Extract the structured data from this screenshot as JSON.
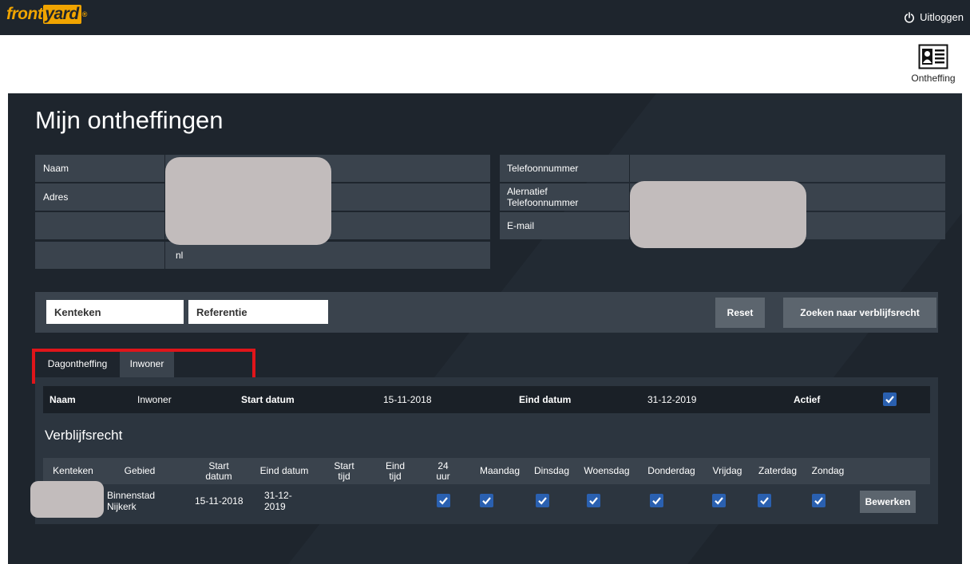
{
  "topbar": {
    "logo_part1": "front",
    "logo_part2": "yard",
    "logo_reg": "®",
    "logout_label": "Uitloggen"
  },
  "nav": {
    "ontheffing_label": "Ontheffing"
  },
  "page": {
    "title": "Mijn ontheffingen"
  },
  "info": {
    "left": {
      "naam_label": "Naam",
      "adres_label": "Adres",
      "country_value": "nl"
    },
    "right": {
      "telefoon_label": "Telefoonnummer",
      "alt_telefoon_label": "Alernatief Telefoonnummer",
      "email_label": "E-mail"
    }
  },
  "search": {
    "kenteken_placeholder": "Kenteken",
    "referentie_placeholder": "Referentie",
    "reset_label": "Reset",
    "zoeken_label": "Zoeken naar verblijfsrecht"
  },
  "tabs": [
    {
      "label": "Dagontheffing",
      "active": true
    },
    {
      "label": "Inwoner",
      "active": false
    }
  ],
  "summary": {
    "naam_label": "Naam",
    "naam_value": "Inwoner",
    "start_label": "Start datum",
    "start_value": "15-11-2018",
    "eind_label": "Eind datum",
    "eind_value": "31-12-2019",
    "actief_label": "Actief",
    "actief_checked": true
  },
  "verblijfsrecht": {
    "title": "Verblijfsrecht",
    "columns": [
      "Kenteken",
      "Gebied",
      "Start datum",
      "Eind datum",
      "Start tijd",
      "Eind tijd",
      "24 uur",
      "Maandag",
      "Dinsdag",
      "Woensdag",
      "Donderdag",
      "Vrijdag",
      "Zaterdag",
      "Zondag"
    ],
    "rows": [
      {
        "gebied": "Binnenstad Nijkerk",
        "start_datum": "15-11-2018",
        "eind_datum": "31-12-2019",
        "checks": [
          true,
          true,
          true,
          true,
          true,
          true,
          true,
          true
        ],
        "edit_label": "Bewerken"
      }
    ]
  },
  "colors": {
    "topbar": "#1e252d",
    "main_bg": "#1e252d",
    "row_bg": "#3a434d",
    "accent_logo": "#f0a400",
    "checkbox": "#2a60b0",
    "highlight": "#e0151a"
  }
}
